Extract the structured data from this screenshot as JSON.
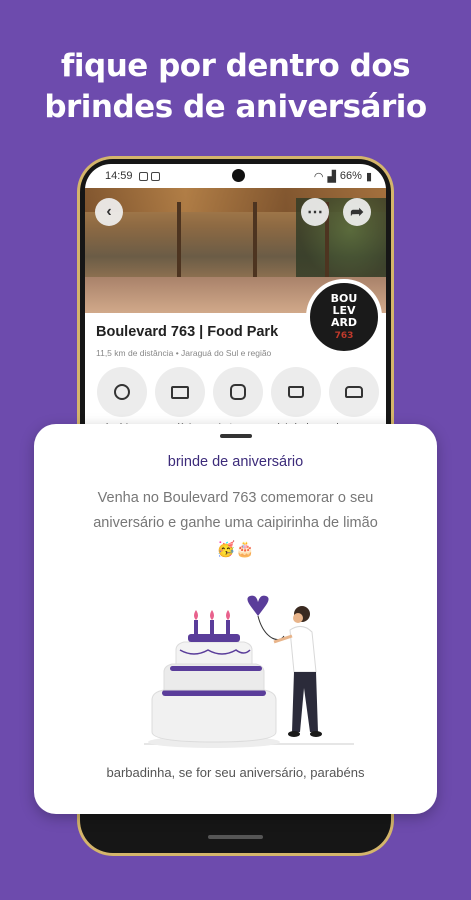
{
  "headline": {
    "line1": "fique por dentro dos",
    "line2": "brindes de aniversário"
  },
  "status_bar": {
    "time": "14:59",
    "battery": "66%"
  },
  "place": {
    "name": "Boulevard 763 | Food Park",
    "subtitle": "11,5 km de distância • Jaraguá do Sul e região",
    "logo_lines": [
      "BOU",
      "LEV",
      "ARD"
    ],
    "logo_number": "763"
  },
  "actions": [
    {
      "label": "horários",
      "icon": "clock-icon"
    },
    {
      "label": "cardápio",
      "icon": "book-icon"
    },
    {
      "label": "instagram",
      "icon": "instagram-icon"
    },
    {
      "label": "brinde de",
      "icon": "cake-icon"
    },
    {
      "label": "chamar um",
      "icon": "car-icon"
    }
  ],
  "sheet": {
    "title": "brinde de aniversário",
    "description": "Venha no Boulevard 763 comemorar o seu aniversário e ganhe uma caipirinha de limão",
    "emojis": "🥳🎂",
    "footer": "barbadinha, se for seu aniversário, parabéns"
  },
  "colors": {
    "background": "#6d4bad",
    "accent": "#3c2b7a",
    "phone_frame": "#d4b56b",
    "cake_purple": "#5a3d9a",
    "candle_flame": "#e8618c"
  }
}
